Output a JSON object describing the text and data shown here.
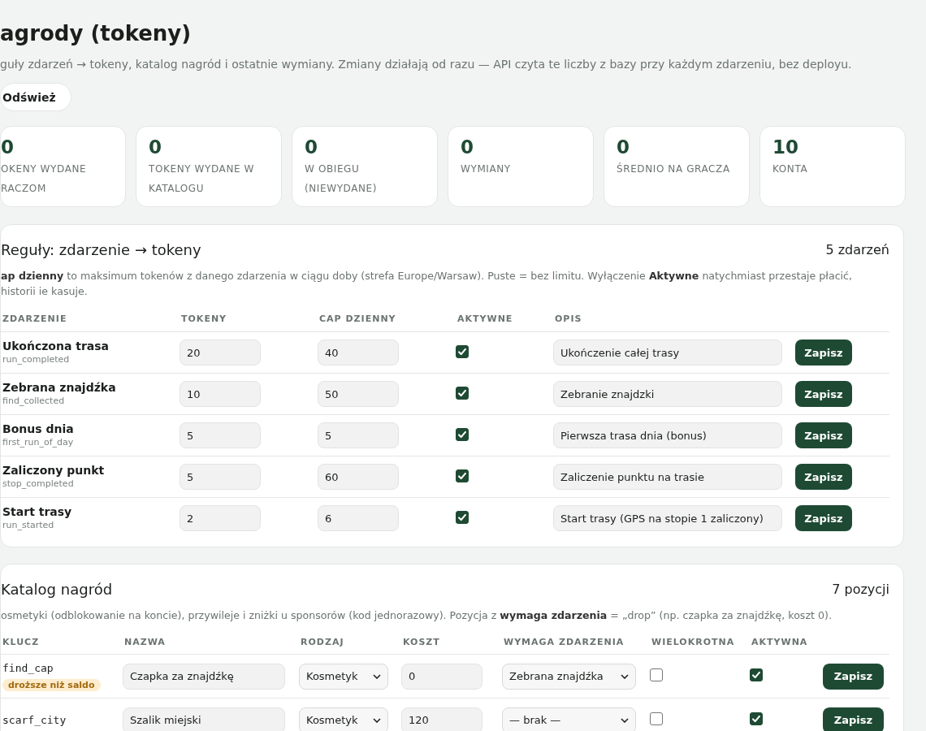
{
  "page": {
    "title": "agrody (tokeny)",
    "subtitle": "guły zdarzeń → tokeny, katalog nagród i ostatnie wymiany. Zmiany działają od razu — API czyta te liczby z bazy przy każdym zdarzeniu, bez deployu.",
    "refresh_button": "Odśwież"
  },
  "stats": [
    {
      "value": "0",
      "label": "OKENY WYDANE RACZOM"
    },
    {
      "value": "0",
      "label": "TOKENY WYDANE W KATALOGU"
    },
    {
      "value": "0",
      "label": "W OBIEGU (NIEWYDANE)"
    },
    {
      "value": "0",
      "label": "WYMIANY"
    },
    {
      "value": "0",
      "label": "ŚREDNIO NA GRACZA"
    },
    {
      "value": "10",
      "label": "KONTA"
    }
  ],
  "rules": {
    "title": "Reguły: zdarzenie → tokeny",
    "count": "5 zdarzeń",
    "note": "**ap dzienny** to maksimum tokenów z danego zdarzenia w ciągu doby (strefa Europe/Warsaw). Puste = bez limitu. Wyłączenie **Aktywne** natychmiast przestaje płacić, historii ie kasuje.",
    "columns": [
      "ZDARZENIE",
      "TOKENY",
      "CAP DZIENNY",
      "AKTYWNE",
      "OPIS"
    ],
    "rows": [
      {
        "name": "Ukończona trasa",
        "key": "run_completed",
        "tokens": "20",
        "cap": "40",
        "active": true,
        "description": "Ukończenie całej trasy",
        "action": "Zapisz"
      },
      {
        "name": "Zebrana znajdźka",
        "key": "find_collected",
        "tokens": "10",
        "cap": "50",
        "active": true,
        "description": "Zebranie znajdzki",
        "action": "Zapisz"
      },
      {
        "name": "Bonus dnia",
        "key": "first_run_of_day",
        "tokens": "5",
        "cap": "5",
        "active": true,
        "description": "Pierwsza trasa dnia (bonus)",
        "action": "Zapisz"
      },
      {
        "name": "Zaliczony punkt",
        "key": "stop_completed",
        "tokens": "5",
        "cap": "60",
        "active": true,
        "description": "Zaliczenie punktu na trasie",
        "action": "Zapisz"
      },
      {
        "name": "Start trasy",
        "key": "run_started",
        "tokens": "2",
        "cap": "6",
        "active": true,
        "description": "Start trasy (GPS na stopie 1 zaliczony)",
        "action": "Zapisz"
      }
    ]
  },
  "catalog": {
    "title": "Katalog nagród",
    "count": "7 pozycji",
    "note": "osmetyki (odblokowanie na koncie), przywileje i zniżki u sponsorów (kod jednorazowy). Pozycja z **wymaga zdarzenia** = „drop” (np. czapka za znajdźkę, koszt 0).",
    "columns": [
      "KLUCZ",
      "NAZWA",
      "RODZAJ",
      "KOSZT",
      "WYMAGA ZDARZENIA",
      "WIELOKROTNA",
      "AKTYWNA"
    ],
    "rows": [
      {
        "key": "find_cap",
        "badge": "droższe niż saldo",
        "name": "Czapka za znajdźkę",
        "kind": "Kosmetyk",
        "cost": "0",
        "requires_event": "Zebrana znajdźka",
        "multiple": false,
        "active": true,
        "action": "Zapisz"
      },
      {
        "key": "scarf_city",
        "name": "Szalik miejski",
        "kind": "Kosmetyk",
        "cost": "120",
        "requires_event": "— brak —",
        "multiple": false,
        "active": true,
        "action": "Zapisz"
      }
    ]
  }
}
